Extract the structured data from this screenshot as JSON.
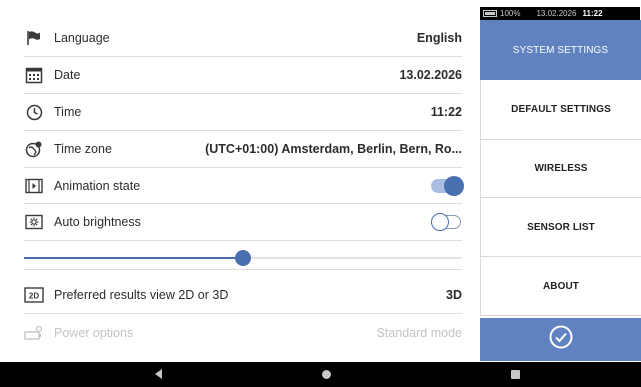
{
  "status": {
    "battery": "100%",
    "date": "13.02.2026",
    "time": "11:22"
  },
  "settings": [
    {
      "label": "Language",
      "value": "English",
      "icon": "flag-icon"
    },
    {
      "label": "Date",
      "value": "13.02.2026",
      "icon": "calendar-icon"
    },
    {
      "label": "Time",
      "value": "11:22",
      "icon": "clock-icon"
    },
    {
      "label": "Time zone",
      "value": "(UTC+01:00) Amsterdam, Berlin, Bern, Ro...",
      "icon": "globe-icon"
    },
    {
      "label": "Animation state",
      "icon": "animation-icon",
      "toggle": "on"
    },
    {
      "label": "Auto brightness",
      "icon": "brightness-icon",
      "toggle": "off"
    },
    {
      "label": "Preferred results view 2D or 3D",
      "value": "3D",
      "icon": "view-2d-icon"
    },
    {
      "label": "Power options",
      "value": "Standard mode",
      "icon": "power-icon",
      "disabled": true
    }
  ],
  "brightness_level": 0.5,
  "menu": {
    "system_settings": "SYSTEM SETTINGS",
    "default_settings": "DEFAULT SETTINGS",
    "wireless": "WIRELESS",
    "sensor_list": "SENSOR LIST",
    "about": "ABOUT"
  },
  "colors": {
    "accent": "#6082c0",
    "toggle_knob": "#4a6fb0",
    "nav_bar": "#000000"
  }
}
